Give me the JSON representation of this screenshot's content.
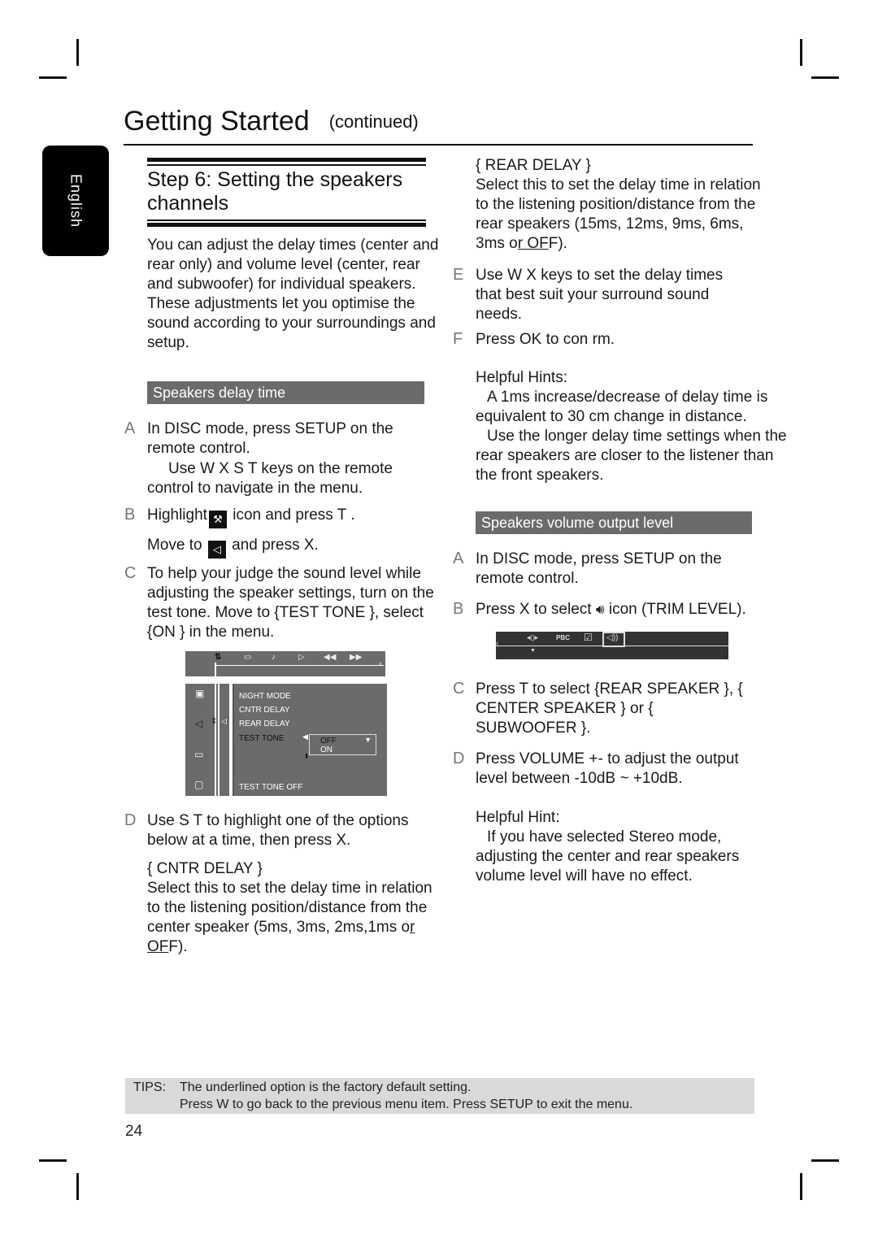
{
  "header": {
    "title": "Getting Started",
    "continued": "(continued)"
  },
  "language_tab": "English",
  "step": {
    "title": "Step 6:  Setting the speakers channels",
    "intro": "You can adjust the delay times (center and rear only) and volume level (center, rear and subwoofer) for individual speakers. These adjustments let you optimise the sound according to your surroundings and setup."
  },
  "delay_section": {
    "heading": "Speakers delay time",
    "steps": [
      {
        "marker": "A",
        "text": "In  DISC  mode, press SETUP  on the remote control."
      },
      {
        "marker": "",
        "text": "Use W X  S  T keys on the remote control to navigate in the menu."
      },
      {
        "marker": "B",
        "text_before": "Highlight",
        "icon": "setup-icon",
        "text_after": " icon and press T ."
      },
      {
        "marker": "",
        "text_before": "Move to ",
        "icon": "speaker-icon",
        "text_after": " and press X."
      },
      {
        "marker": "C",
        "text": "To help your judge the sound level while adjusting the speaker settings, turn on the test tone. Move to {TEST TONE   }, select {ON  } in the menu."
      },
      {
        "marker": "D",
        "text": "Use S T  to highlight one of the options below at a time, then press X."
      }
    ],
    "menu": {
      "top_icons": [
        "setup-icon",
        "subtitle-icon",
        "audio-icon",
        "play-icon",
        "rewind-icon",
        "fast-forward-icon"
      ],
      "left_icons": [
        "picture-icon",
        "speaker-icon",
        "language-icon",
        "preference-icon"
      ],
      "items": [
        "NIGHT MODE",
        "CNTR DELAY",
        "REAR DELAY",
        "TEST TONE"
      ],
      "active_item": "TEST TONE",
      "options": [
        "OFF",
        "ON"
      ],
      "status": "TEST TONE OFF"
    },
    "cntr_delay": {
      "label": "{ CNTR DELAY   }",
      "text": "Select this to set the delay time in relation to the listening position/distance from the center speaker (5ms, 3ms, 2ms,1ms o",
      "default": "r OF",
      "tail": "F)."
    },
    "rear_delay": {
      "label": "{ REAR DELAY  }",
      "text": "Select this to set the delay time in relation to the listening position/distance from the rear speakers (15ms, 12ms, 9ms, 6ms, 3ms o",
      "default": "r OF",
      "tail": "F)."
    },
    "steps_after": [
      {
        "marker": "E",
        "text": "Use W X keys to set the delay times that best suit your surround sound needs."
      },
      {
        "marker": "F",
        "text": "Press OK  to con rm."
      }
    ],
    "hints_title": "Helpful Hints:",
    "hints": [
      "A 1ms increase/decrease of delay time is equivalent to 30 cm change in distance.",
      "Use the longer delay time settings when the rear speakers are closer to the listener than the front speakers."
    ]
  },
  "volume_section": {
    "heading": "Speakers volume output level",
    "steps": [
      {
        "marker": "A",
        "text": "In  DISC  mode, press SETUP  on the remote control."
      },
      {
        "marker": "B",
        "text_before": "Press X to select ",
        "icon": "trim-level-icon",
        "text_after": " icon (TRIM LEVEL)."
      },
      {
        "marker": "C",
        "text": "Press T  to select {REAR SPEAKER }, { CENTER SPEAKER  } or { SUBWOOFER   }."
      },
      {
        "marker": "D",
        "text": "Press VOLUME  +-      to adjust the output level between -10dB ~ +10dB."
      }
    ],
    "bar_icons": [
      "zoom-icon",
      "pbc-label",
      "checkbox-icon",
      "trim-level-icon"
    ],
    "bar_pbc": "PBC",
    "hint_title": "Helpful Hint:",
    "hint": "If you have selected Stereo mode, adjusting the center and rear speakers volume level will have no effect."
  },
  "tips": {
    "label": "TIPS:",
    "line1": "The underlined option is the factory default setting.",
    "line2": "Press W to go back to the previous menu item.  Press SETUP  to exit the menu."
  },
  "page_number": "24"
}
